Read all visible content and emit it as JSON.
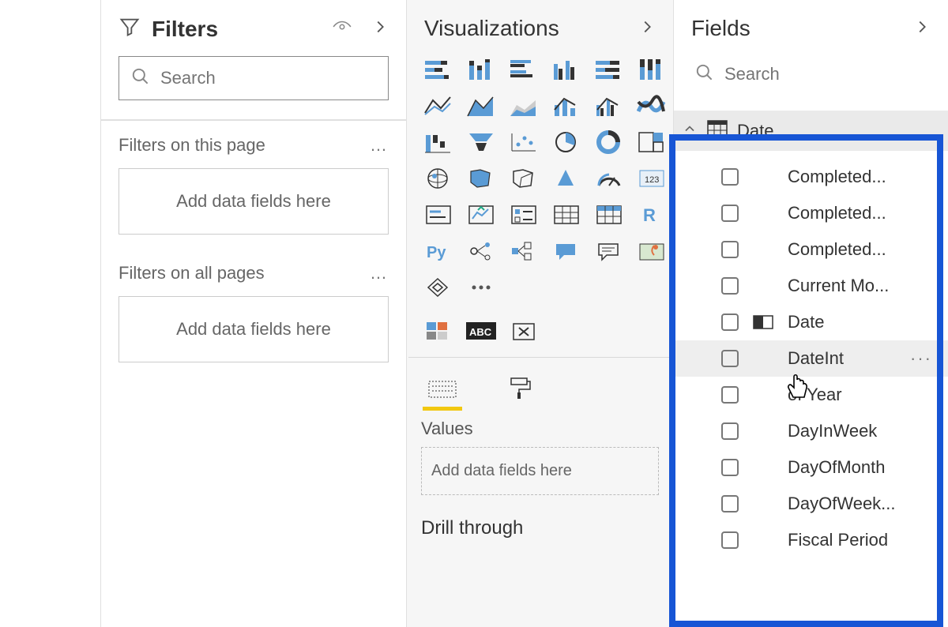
{
  "filters": {
    "title": "Filters",
    "search_placeholder": "Search",
    "sections": [
      {
        "label": "Filters on this page",
        "drop": "Add data fields here"
      },
      {
        "label": "Filters on all pages",
        "drop": "Add data fields here"
      }
    ]
  },
  "viz": {
    "title": "Visualizations",
    "values_label": "Values",
    "values_drop": "Add data fields here",
    "drill_label": "Drill through"
  },
  "fields": {
    "title": "Fields",
    "search_placeholder": "Search",
    "table": "Date",
    "items": [
      {
        "name": "Completed...",
        "hasIcon": false
      },
      {
        "name": "Completed...",
        "hasIcon": false
      },
      {
        "name": "Completed...",
        "hasIcon": false
      },
      {
        "name": "Current Mo...",
        "hasIcon": false
      },
      {
        "name": "Date",
        "hasIcon": true
      },
      {
        "name": "DateInt",
        "hasIcon": false,
        "hover": true
      },
      {
        "name": "of Year",
        "hasIcon": false,
        "cursor": true
      },
      {
        "name": "DayInWeek",
        "hasIcon": false
      },
      {
        "name": "DayOfMonth",
        "hasIcon": false
      },
      {
        "name": "DayOfWeek...",
        "hasIcon": false
      },
      {
        "name": "Fiscal Period",
        "hasIcon": false
      }
    ]
  }
}
